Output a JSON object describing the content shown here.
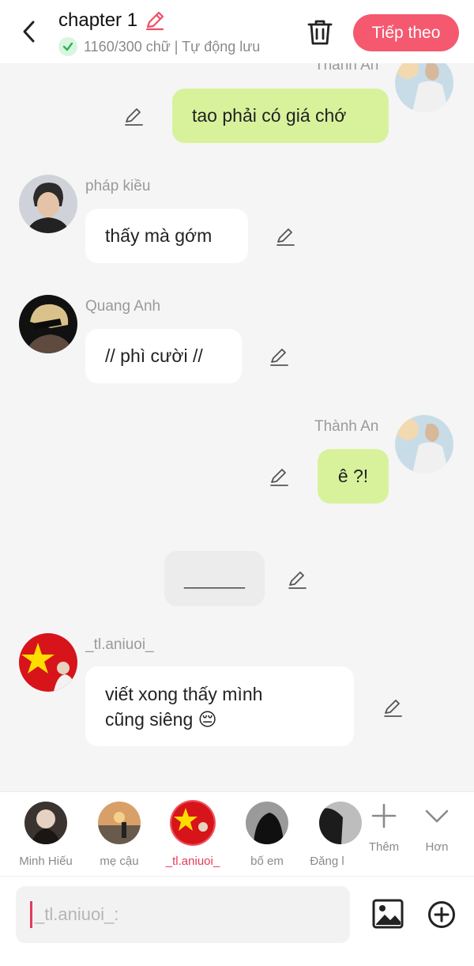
{
  "header": {
    "title": "chapter 1",
    "status": "1160/300 chữ | Tự động lưu",
    "next_label": "Tiếp theo",
    "accent": "#f4596f"
  },
  "messages": [
    {
      "sender": "Thành An",
      "text": "tao phải có giá chớ",
      "side": "right"
    },
    {
      "sender": "pháp kiều",
      "text": "thấy mà gớm",
      "side": "left"
    },
    {
      "sender": "Quang Anh",
      "text": "// phì cười //",
      "side": "left"
    },
    {
      "sender": "Thành An",
      "text": "ê ?!",
      "side": "right"
    },
    {
      "sender": "",
      "text": "______",
      "side": "center"
    },
    {
      "sender": "_tl.aniuoi_",
      "line1": "viết xong thấy mình",
      "line2": "cũng siêng 😔",
      "side": "left"
    }
  ],
  "characters": [
    {
      "name": "Minh Hiếu"
    },
    {
      "name": "mẹ cậu"
    },
    {
      "name": "_tl.aniuoi_",
      "selected": true
    },
    {
      "name": "bố em"
    },
    {
      "name": "Đăng l"
    }
  ],
  "bar_actions": {
    "add_label": "Thêm",
    "more_label": "Hơn"
  },
  "input": {
    "placeholder": "_tl.aniuoi_:"
  },
  "icons": [
    "back-arrow-icon",
    "pencil-icon",
    "check-icon",
    "trash-icon",
    "plus-icon",
    "chevron-down-icon",
    "image-icon",
    "plus-circle-icon"
  ]
}
